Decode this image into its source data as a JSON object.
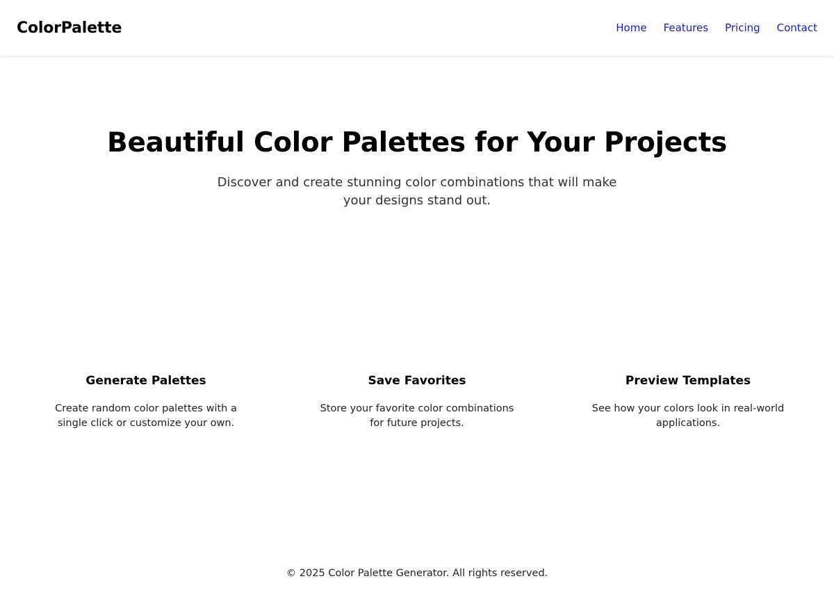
{
  "header": {
    "logo": "ColorPalette",
    "nav": [
      {
        "label": "Home"
      },
      {
        "label": "Features"
      },
      {
        "label": "Pricing"
      },
      {
        "label": "Contact"
      }
    ]
  },
  "hero": {
    "title": "Beautiful Color Palettes for Your Projects",
    "subtitle": "Discover and create stunning color combinations that will make your designs stand out."
  },
  "features": [
    {
      "title": "Generate Palettes",
      "description": "Create random color palettes with a single click or customize your own."
    },
    {
      "title": "Save Favorites",
      "description": "Store your favorite color combinations for future projects."
    },
    {
      "title": "Preview Templates",
      "description": "See how your colors look in real-world applications."
    }
  ],
  "footer": {
    "text": "© 2025 Color Palette Generator. All rights reserved."
  },
  "colors": {
    "nav_link": "#1a1acd",
    "text": "#000000"
  }
}
